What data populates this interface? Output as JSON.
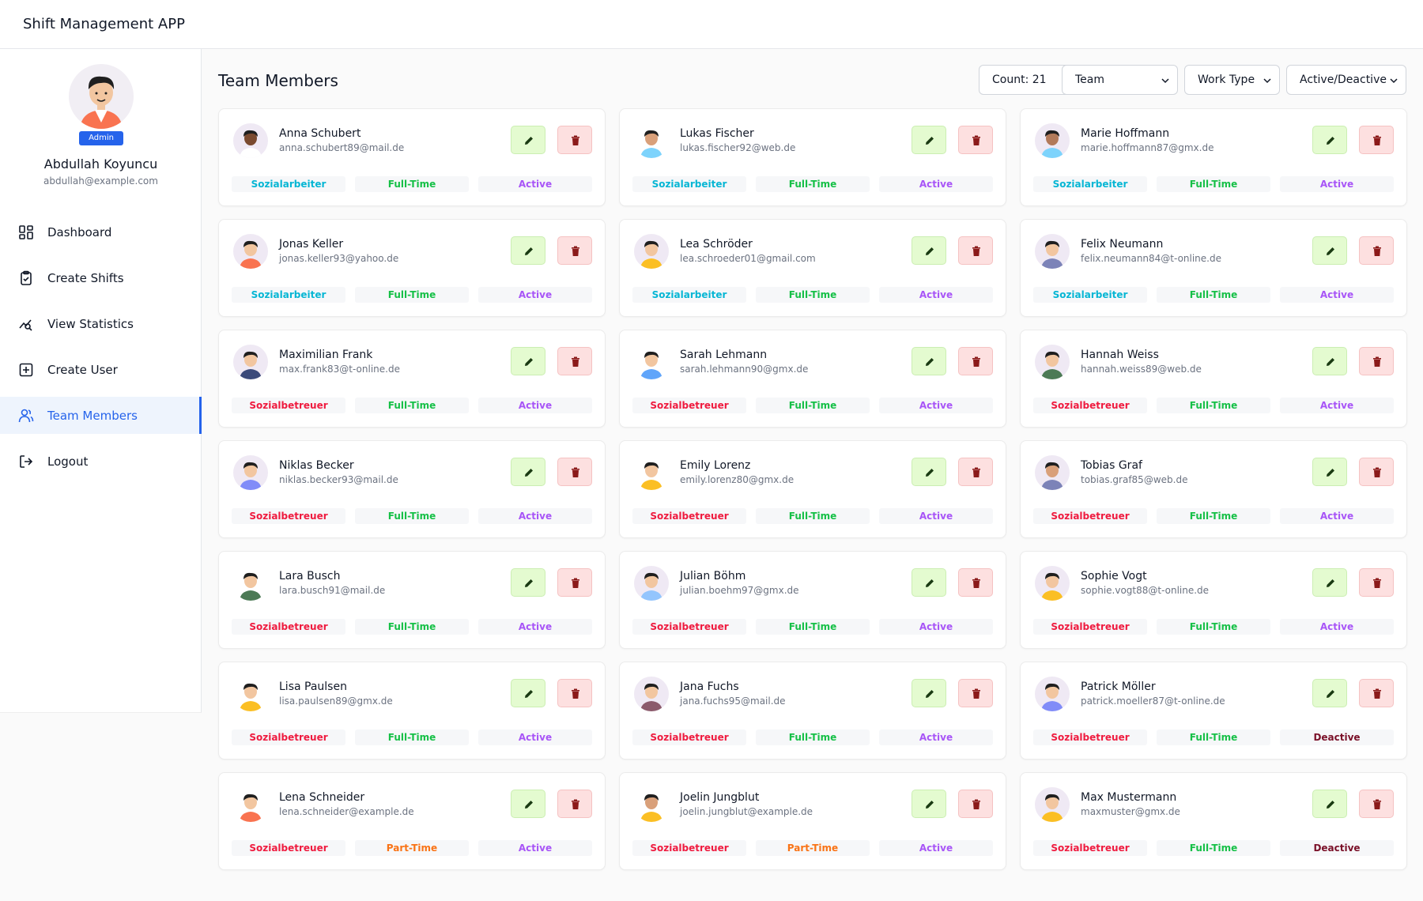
{
  "app": {
    "title": "Shift Management APP"
  },
  "profile": {
    "name": "Abdullah Koyuncu",
    "email": "abdullah@example.com",
    "role": "Admin"
  },
  "nav": [
    {
      "label": "Dashboard",
      "icon": "dashboard-icon"
    },
    {
      "label": "Create Shifts",
      "icon": "clipboard-check-icon"
    },
    {
      "label": "View Statistics",
      "icon": "statistics-icon"
    },
    {
      "label": "Create User",
      "icon": "plus-square-icon"
    },
    {
      "label": "Team Members",
      "icon": "users-icon",
      "active": true
    },
    {
      "label": "Logout",
      "icon": "logout-icon"
    }
  ],
  "page": {
    "title": "Team Members"
  },
  "filters": {
    "count_label": "Count: 21",
    "team": "Team",
    "work_type": "Work Type",
    "status": "Active/Deactive"
  },
  "colors": {
    "Sozialarbeiter": "#06b6d4",
    "Sozialbetreuer": "#ef1b3f",
    "Full-Time": "#16c047",
    "Part-Time": "#f97316",
    "Active": "#a855f7",
    "Deactive": "#7a1028",
    "accent": "#2563eb"
  },
  "members": [
    {
      "name": "Anna Schubert",
      "email": "anna.schubert89@mail.de",
      "role": "Sozialarbeiter",
      "work": "Full-Time",
      "status": "Active",
      "avatar_bg": "#efe9f4",
      "skin": "#7a4a2f",
      "shirt": "#ffffff"
    },
    {
      "name": "Lukas Fischer",
      "email": "lukas.fischer92@web.de",
      "role": "Sozialarbeiter",
      "work": "Full-Time",
      "status": "Active",
      "avatar_bg": "#ffffff",
      "skin": "#d9a07a",
      "shirt": "#7dd3fc"
    },
    {
      "name": "Marie Hoffmann",
      "email": "marie.hoffmann87@gmx.de",
      "role": "Sozialarbeiter",
      "work": "Full-Time",
      "status": "Active",
      "avatar_bg": "#efe9f4",
      "skin": "#b27a5a",
      "shirt": "#7dd3fc"
    },
    {
      "name": "Jonas Keller",
      "email": "jonas.keller93@yahoo.de",
      "role": "Sozialarbeiter",
      "work": "Full-Time",
      "status": "Active",
      "avatar_bg": "#efe9f4",
      "skin": "#f2c6a0",
      "shirt": "#f97350"
    },
    {
      "name": "Lea Schröder",
      "email": "lea.schroeder01@gmail.com",
      "role": "Sozialarbeiter",
      "work": "Full-Time",
      "status": "Active",
      "avatar_bg": "#efe9f4",
      "skin": "#f2c6a0",
      "shirt": "#fbbf24"
    },
    {
      "name": "Felix Neumann",
      "email": "felix.neumann84@t-online.de",
      "role": "Sozialarbeiter",
      "work": "Full-Time",
      "status": "Active",
      "avatar_bg": "#efe9f4",
      "skin": "#f2c6a0",
      "shirt": "#7c83b8"
    },
    {
      "name": "Maximilian Frank",
      "email": "max.frank83@t-online.de",
      "role": "Sozialbetreuer",
      "work": "Full-Time",
      "status": "Active",
      "avatar_bg": "#efe9f4",
      "skin": "#f2c6a0",
      "shirt": "#3b4a7a"
    },
    {
      "name": "Sarah Lehmann",
      "email": "sarah.lehmann90@gmx.de",
      "role": "Sozialbetreuer",
      "work": "Full-Time",
      "status": "Active",
      "avatar_bg": "#ffffff",
      "skin": "#f2c6a0",
      "shirt": "#60a5fa"
    },
    {
      "name": "Hannah Weiss",
      "email": "hannah.weiss89@web.de",
      "role": "Sozialbetreuer",
      "work": "Full-Time",
      "status": "Active",
      "avatar_bg": "#efe9f4",
      "skin": "#f2c6a0",
      "shirt": "#4c7a55"
    },
    {
      "name": "Niklas Becker",
      "email": "niklas.becker93@mail.de",
      "role": "Sozialbetreuer",
      "work": "Full-Time",
      "status": "Active",
      "avatar_bg": "#efe9f4",
      "skin": "#f2c6a0",
      "shirt": "#818cf8"
    },
    {
      "name": "Emily Lorenz",
      "email": "emily.lorenz80@gmx.de",
      "role": "Sozialbetreuer",
      "work": "Full-Time",
      "status": "Active",
      "avatar_bg": "#ffffff",
      "skin": "#f2c6a0",
      "shirt": "#fbbf24"
    },
    {
      "name": "Tobias Graf",
      "email": "tobias.graf85@web.de",
      "role": "Sozialbetreuer",
      "work": "Full-Time",
      "status": "Active",
      "avatar_bg": "#efe9f4",
      "skin": "#d9a07a",
      "shirt": "#7c83b8"
    },
    {
      "name": "Lara Busch",
      "email": "lara.busch91@mail.de",
      "role": "Sozialbetreuer",
      "work": "Full-Time",
      "status": "Active",
      "avatar_bg": "#ffffff",
      "skin": "#f2c6a0",
      "shirt": "#4c7a55"
    },
    {
      "name": "Julian Böhm",
      "email": "julian.boehm97@gmx.de",
      "role": "Sozialbetreuer",
      "work": "Full-Time",
      "status": "Active",
      "avatar_bg": "#efe9f4",
      "skin": "#f2c6a0",
      "shirt": "#93c5fd"
    },
    {
      "name": "Sophie Vogt",
      "email": "sophie.vogt88@t-online.de",
      "role": "Sozialbetreuer",
      "work": "Full-Time",
      "status": "Active",
      "avatar_bg": "#efe9f4",
      "skin": "#f2c6a0",
      "shirt": "#fbbf24"
    },
    {
      "name": "Lisa Paulsen",
      "email": "lisa.paulsen89@gmx.de",
      "role": "Sozialbetreuer",
      "work": "Full-Time",
      "status": "Active",
      "avatar_bg": "#ffffff",
      "skin": "#f2c6a0",
      "shirt": "#fbbf24"
    },
    {
      "name": "Jana Fuchs",
      "email": "jana.fuchs95@mail.de",
      "role": "Sozialbetreuer",
      "work": "Full-Time",
      "status": "Active",
      "avatar_bg": "#efe9f4",
      "skin": "#f2c6a0",
      "shirt": "#8b5a6b"
    },
    {
      "name": "Patrick Möller",
      "email": "patrick.moeller87@t-online.de",
      "role": "Sozialbetreuer",
      "work": "Full-Time",
      "status": "Deactive",
      "avatar_bg": "#efe9f4",
      "skin": "#f2c6a0",
      "shirt": "#818cf8"
    },
    {
      "name": "Lena Schneider",
      "email": "lena.schneider@example.de",
      "role": "Sozialbetreuer",
      "work": "Part-Time",
      "status": "Active",
      "avatar_bg": "#ffffff",
      "skin": "#f2c6a0",
      "shirt": "#f97350"
    },
    {
      "name": "Joelin Jungblut",
      "email": "joelin.jungblut@example.de",
      "role": "Sozialbetreuer",
      "work": "Part-Time",
      "status": "Active",
      "avatar_bg": "#ffffff",
      "skin": "#d9a07a",
      "shirt": "#fbbf24"
    },
    {
      "name": "Max Mustermann",
      "email": "maxmuster@gmx.de",
      "role": "Sozialbetreuer",
      "work": "Full-Time",
      "status": "Deactive",
      "avatar_bg": "#efe9f4",
      "skin": "#f2c6a0",
      "shirt": "#fbbf24"
    }
  ]
}
